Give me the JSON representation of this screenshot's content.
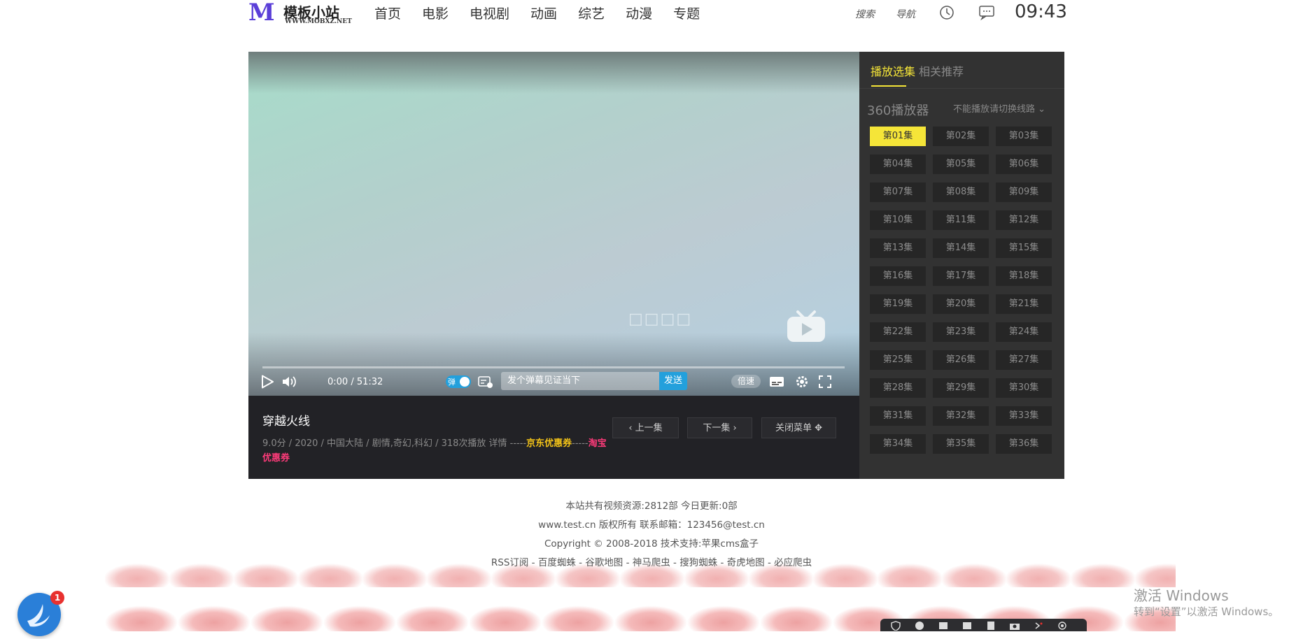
{
  "header": {
    "logo_mark": "M",
    "logo_text": "模板小站",
    "logo_sub": "WWW.MOBXZ.NET",
    "nav": [
      "首页",
      "电影",
      "电视剧",
      "动画",
      "综艺",
      "动漫",
      "专题"
    ],
    "search_label": "搜索",
    "guide_label": "导航",
    "clock": "09:43"
  },
  "player": {
    "time": "0:00 / 51:32",
    "progress": 0,
    "danmaku_toggle_label": "弹",
    "danmaku_placeholder": "发个弹幕见证当下",
    "send_label": "发送",
    "speed_label": "倍速",
    "center_glyphs": "□□□□"
  },
  "info": {
    "title": "穿越火线",
    "meta_prefix": "9.0分 / 2020 / 中国大陆 / 剧情,奇幻,科幻 / 318次播放  详情 -----",
    "jd_coupon": "京东优惠券",
    "meta_mid": "-----",
    "taobao_coupon": "淘宝优惠券",
    "prev_label": "上一集",
    "next_label": "下一集",
    "close_menu_label": "关闭菜单"
  },
  "sidebar": {
    "tab_active": "播放选集",
    "tab_other": "相关推荐",
    "source_name": "360播放器",
    "switch_hint": "不能播放请切换线路",
    "episodes": [
      "第01集",
      "第02集",
      "第03集",
      "第04集",
      "第05集",
      "第06集",
      "第07集",
      "第08集",
      "第09集",
      "第10集",
      "第11集",
      "第12集",
      "第13集",
      "第14集",
      "第15集",
      "第16集",
      "第17集",
      "第18集",
      "第19集",
      "第20集",
      "第21集",
      "第22集",
      "第23集",
      "第24集",
      "第25集",
      "第26集",
      "第27集",
      "第28集",
      "第29集",
      "第30集",
      "第31集",
      "第32集",
      "第33集",
      "第34集",
      "第35集",
      "第36集"
    ],
    "active_episode": 0
  },
  "footer": {
    "line1": "本站共有视频资源:2812部 今日更新:0部",
    "line2": "www.test.cn 版权所有 联系邮箱：123456@test.cn",
    "line3": "Copyright © 2008-2018 技术支持:苹果cms盒子",
    "line4": "RSS订阅 - 百度蜘蛛 - 谷歌地图 - 神马爬虫 - 搜狗蜘蛛 - 奇虎地图 - 必应爬虫"
  },
  "windows": {
    "activate_title": "激活 Windows",
    "activate_sub": "转到“设置”以激活 Windows。"
  },
  "notify_badge": "1",
  "colors": {
    "accent_yellow": "#f5e538",
    "accent_blue": "#23a0dc",
    "sidebar_bg": "#323232",
    "infobar_bg": "#222226"
  }
}
